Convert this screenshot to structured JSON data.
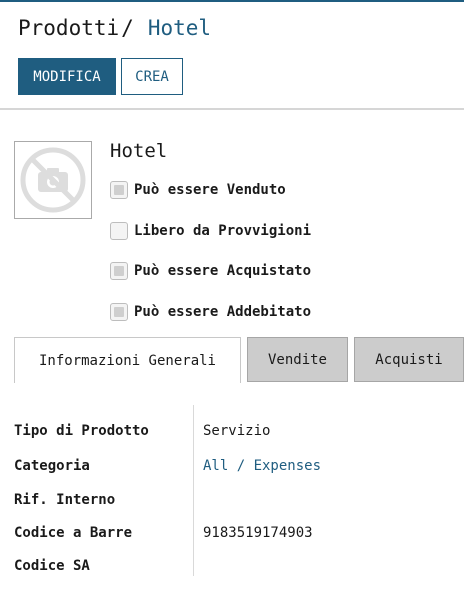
{
  "breadcrumb": {
    "parent": "Prodotti",
    "separator": "/",
    "current": "Hotel"
  },
  "buttons": {
    "edit": "MODIFICA",
    "create": "CREA"
  },
  "product": {
    "image_icon": "camera-off-icon",
    "name": "Hotel"
  },
  "checkboxes": [
    {
      "label": "Può essere Venduto",
      "checked": true,
      "disabled": true
    },
    {
      "label": "Libero da Provvigioni",
      "checked": false,
      "disabled": false
    },
    {
      "label": "Può essere Acquistato",
      "checked": true,
      "disabled": true
    },
    {
      "label": "Può essere Addebitato",
      "checked": true,
      "disabled": true
    }
  ],
  "tabs": [
    {
      "label": "Informazioni Generali",
      "active": true
    },
    {
      "label": "Vendite",
      "active": false
    },
    {
      "label": "Acquisti",
      "active": false
    }
  ],
  "fields": [
    {
      "label": "Tipo di Prodotto",
      "value": "Servizio"
    },
    {
      "label": "Categoria",
      "value": "All / Expenses"
    },
    {
      "label": "Rif. Interno",
      "value": ""
    },
    {
      "label": "Codice a Barre",
      "value": "9183519174903"
    },
    {
      "label": "Codice SA",
      "value": ""
    }
  ],
  "colors": {
    "primary": "#1f5d80",
    "tab_inactive": "#cccccc"
  }
}
